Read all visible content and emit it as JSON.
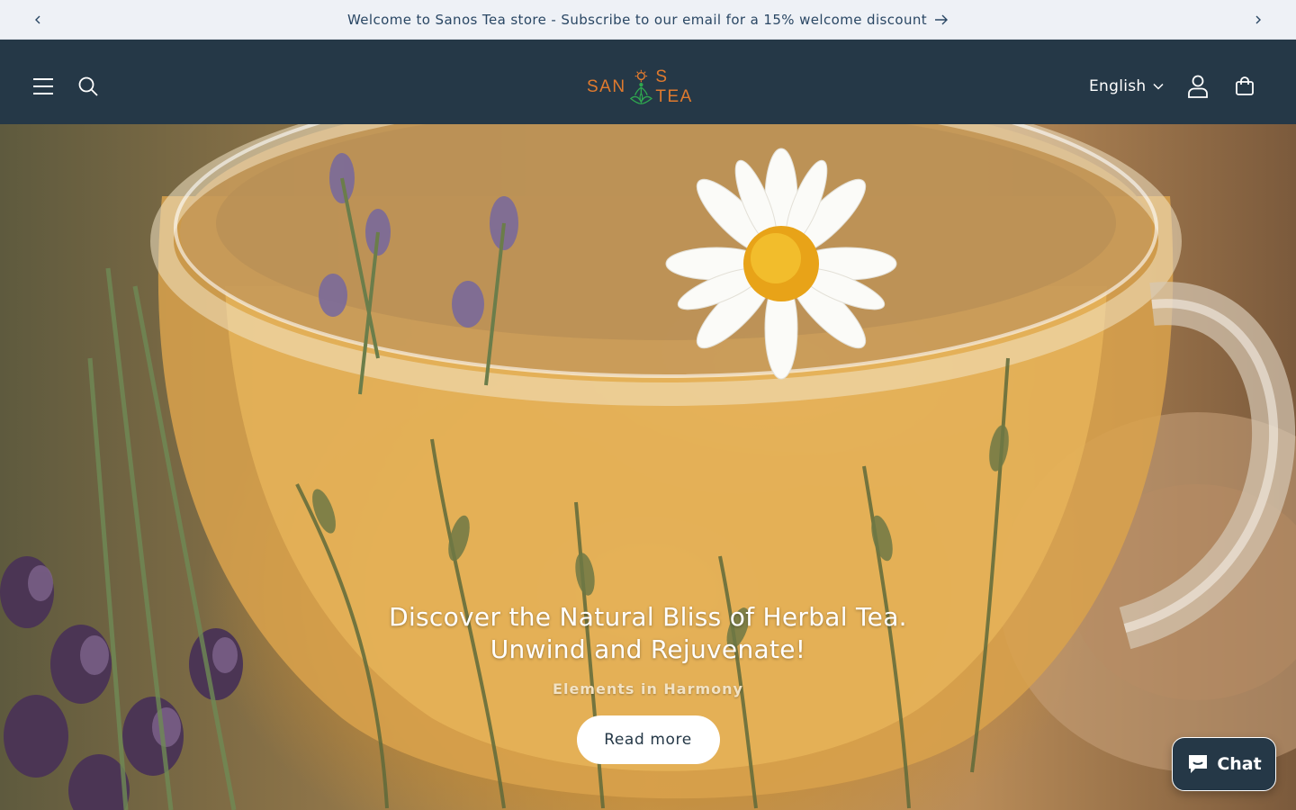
{
  "announcement": {
    "text": "Welcome to Sanos Tea store - Subscribe to our email for a 15% welcome discount",
    "prev_icon": "chevron-left-icon",
    "next_icon": "chevron-right-icon",
    "link_icon": "arrow-right-icon"
  },
  "header": {
    "logo_text_left": "SAN",
    "logo_text_right": "S TEA",
    "language": "English",
    "icons": {
      "menu": "hamburger-icon",
      "search": "search-icon",
      "account": "user-icon",
      "cart": "shopping-bag-icon"
    }
  },
  "hero": {
    "title": "Discover the Natural Bliss of Herbal Tea. Unwind and Rejuvenate!",
    "subtitle": "Elements in Harmony",
    "button_label": "Read more"
  },
  "chat": {
    "label": "Chat",
    "icon": "chat-bubble-icon"
  },
  "colors": {
    "announcement_bg": "#eef1f6",
    "header_bg": "#253847",
    "logo_orange": "#e07a2e",
    "logo_green": "#2fa84f",
    "chat_bg": "#253847"
  }
}
